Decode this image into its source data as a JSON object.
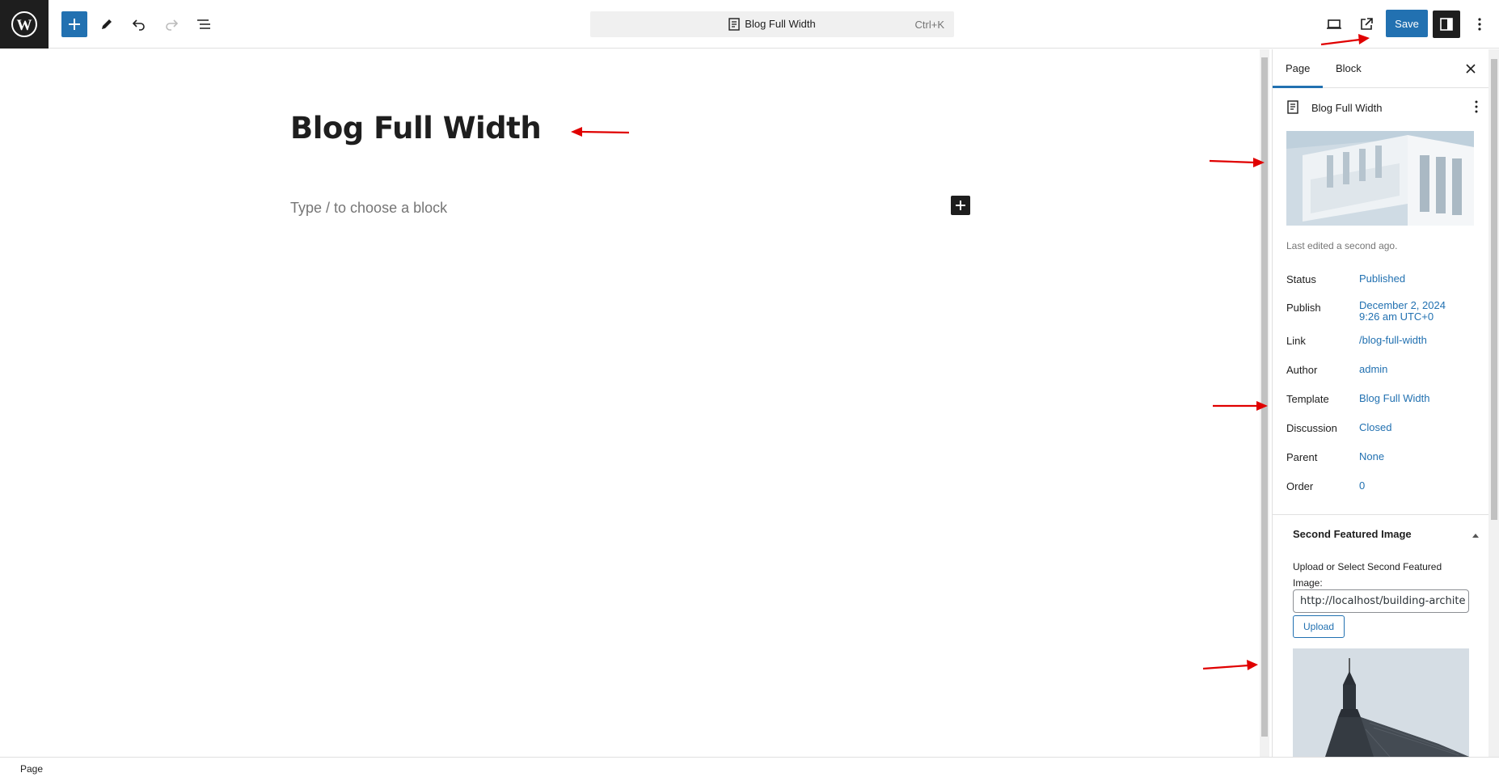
{
  "toolbar": {
    "document_title": "Blog Full Width",
    "shortcut": "Ctrl+K",
    "save_label": "Save"
  },
  "canvas": {
    "title": "Blog Full Width",
    "placeholder": "Type / to choose a block"
  },
  "sidebar": {
    "tabs": [
      {
        "label": "Page"
      },
      {
        "label": "Block"
      }
    ],
    "document_title": "Blog Full Width",
    "last_edited": "Last edited a second ago.",
    "meta": [
      {
        "label": "Status",
        "value": "Published"
      },
      {
        "label": "Publish",
        "value": "December 2, 2024",
        "value2": "9:26 am UTC+0"
      },
      {
        "label": "Link",
        "value": "/blog-full-width"
      },
      {
        "label": "Author",
        "value": "admin"
      },
      {
        "label": "Template",
        "value": "Blog Full Width"
      },
      {
        "label": "Discussion",
        "value": "Closed"
      },
      {
        "label": "Parent",
        "value": "None"
      },
      {
        "label": "Order",
        "value": "0"
      }
    ],
    "second_featured": {
      "title": "Second Featured Image",
      "label": "Upload or Select Second Featured Image:",
      "url_value": "http://localhost/building-archite",
      "upload_label": "Upload"
    }
  },
  "footer": {
    "breadcrumb": "Page"
  },
  "colors": {
    "accent": "#2271b1",
    "dark": "#1e1e1e",
    "annotation": "#e00000"
  }
}
